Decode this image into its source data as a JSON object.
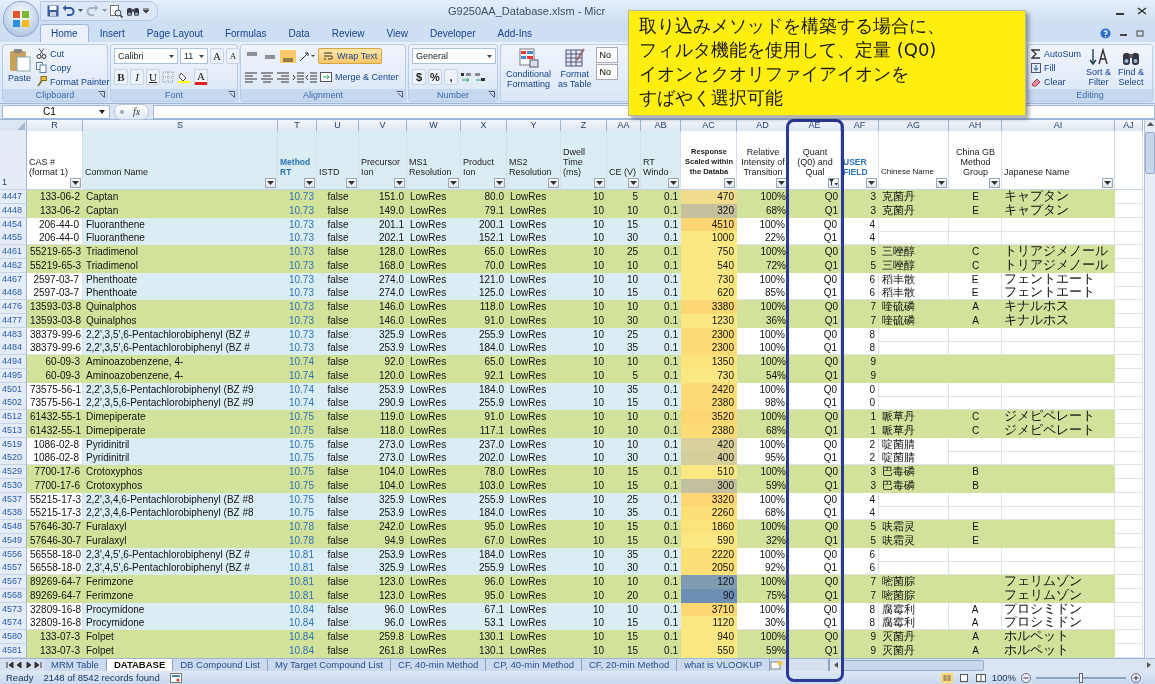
{
  "window": {
    "title": "G9250AA_Database.xlsm - Micr"
  },
  "ribbon": {
    "tabs": [
      {
        "label": "Home",
        "selected": true
      },
      {
        "label": "Insert",
        "selected": false
      },
      {
        "label": "Page Layout",
        "selected": false
      },
      {
        "label": "Formulas",
        "selected": false
      },
      {
        "label": "Data",
        "selected": false
      },
      {
        "label": "Review",
        "selected": false
      },
      {
        "label": "View",
        "selected": false
      },
      {
        "label": "Developer",
        "selected": false
      },
      {
        "label": "Add-Ins",
        "selected": false
      }
    ],
    "clipboard": {
      "label": "Clipboard",
      "paste": "Paste",
      "cut": "Cut",
      "copy": "Copy",
      "format_painter": "Format Painter"
    },
    "font": {
      "label": "Font",
      "family": "Calibri",
      "size": "11",
      "grow": "A",
      "shrink": "A",
      "bold": "B",
      "italic": "I",
      "underline": "U",
      "font_color": "A"
    },
    "alignment": {
      "label": "Alignment",
      "vertical_align": [
        {
          "selected": false
        },
        {
          "selected": false
        },
        {
          "selected": true
        }
      ],
      "wrap_text": {
        "label": "Wrap Text",
        "on": true
      },
      "merge": "Merge & Center"
    },
    "number": {
      "label": "Number",
      "format": "General",
      "currency": "$",
      "percent": "%",
      "comma": ","
    },
    "styles": {
      "conditional": [
        "Conditional",
        "Formatting"
      ],
      "format_table": [
        "Format",
        "as Table"
      ],
      "style_cells": [
        "No",
        "No"
      ]
    },
    "editing": {
      "label": "Editing",
      "autosum": "AutoSum",
      "fill": "Fill",
      "clear": "Clear",
      "sort": [
        "Sort &",
        "Filter"
      ],
      "find": [
        "Find &",
        "Select"
      ]
    }
  },
  "formula_bar": {
    "name_box": "C1",
    "function_label": "fx"
  },
  "callout": {
    "lines": [
      "取り込みメソッドを構築する場合に、",
      "フィルタ機能を使用して、定量 (Q0)",
      "イオンとクオリファイアイオンを",
      "すばやく選択可能"
    ]
  },
  "sheet": {
    "header_row": "1",
    "columns": [
      {
        "letter": "R",
        "header": [
          "CAS #",
          "(format 1)"
        ],
        "kind": "plain",
        "filtered": false,
        "tinted": false
      },
      {
        "letter": "S",
        "header": [
          "Common Name"
        ],
        "kind": "plain",
        "filtered": false,
        "tinted": true
      },
      {
        "letter": "T",
        "header": [
          "Method",
          "RT"
        ],
        "kind": "accent",
        "filtered": false,
        "tinted": true
      },
      {
        "letter": "U",
        "header": [
          "ISTD"
        ],
        "kind": "plain",
        "filtered": false,
        "tinted": true
      },
      {
        "letter": "V",
        "header": [
          "Precursor",
          "Ion"
        ],
        "kind": "plain",
        "filtered": false,
        "tinted": true
      },
      {
        "letter": "W",
        "header": [
          "MS1",
          "Resolution"
        ],
        "kind": "plain",
        "filtered": false,
        "tinted": true
      },
      {
        "letter": "X",
        "header": [
          "Product",
          "Ion"
        ],
        "kind": "plain",
        "filtered": false,
        "tinted": true
      },
      {
        "letter": "Y",
        "header": [
          "MS2",
          "Resolution"
        ],
        "kind": "plain",
        "filtered": false,
        "tinted": true
      },
      {
        "letter": "Z",
        "header": [
          "Dwell",
          "Time",
          "(ms)"
        ],
        "kind": "plain",
        "filtered": false,
        "tinted": true
      },
      {
        "letter": "AA",
        "header": [
          "CE (V)"
        ],
        "kind": "plain",
        "filtered": false,
        "tinted": true
      },
      {
        "letter": "AB",
        "header": [
          "RT",
          "Windo"
        ],
        "kind": "plain",
        "filtered": false,
        "tinted": true
      },
      {
        "letter": "AC",
        "header": [
          "Response",
          "Scaled within",
          "the Databa"
        ],
        "kind": "bold",
        "filtered": false,
        "tinted": false
      },
      {
        "letter": "AD",
        "header": [
          "Relative",
          "Intensity of",
          "Transition"
        ],
        "kind": "plain",
        "filtered": false,
        "tinted": false
      },
      {
        "letter": "AE",
        "header": [
          "Quant",
          "(Q0) and",
          "Qual"
        ],
        "kind": "plain",
        "filtered": true,
        "tinted": false
      },
      {
        "letter": "AF",
        "header": [
          "USER",
          "FIELD"
        ],
        "kind": "accent",
        "filtered": false,
        "tinted": false
      },
      {
        "letter": "AG",
        "header": [
          "Chinese Name"
        ],
        "kind": "small",
        "filtered": false,
        "tinted": false
      },
      {
        "letter": "AH",
        "header": [
          "China GB",
          "Method",
          "Group"
        ],
        "kind": "plain",
        "filtered": false,
        "tinted": false
      },
      {
        "letter": "AI",
        "header": [
          "Japanese Name"
        ],
        "kind": "plain",
        "filtered": false,
        "tinted": false
      },
      {
        "letter": "AJ",
        "tinted": false
      }
    ],
    "rows": [
      {
        "row": "4447",
        "kind": "odd",
        "cas": "133-06-2",
        "name": "Captan",
        "rt": "10.73",
        "istd": "false",
        "precursor": "151.0",
        "ms1": "LowRes",
        "product": "80.0",
        "ms2": "LowRes",
        "dwell": "10",
        "ce": "5",
        "rt_window": "0.1",
        "response": "470",
        "color": "#f0dc8c",
        "relative": "100%",
        "quant": "Q0",
        "user_field": "3",
        "chinese": "克菌丹",
        "gb": "E",
        "japanese": "キャプタン"
      },
      {
        "row": "4448",
        "kind": "odd",
        "cas": "133-06-2",
        "name": "Captan",
        "rt": "10.73",
        "istd": "false",
        "precursor": "149.0",
        "ms1": "LowRes",
        "product": "79.1",
        "ms2": "LowRes",
        "dwell": "10",
        "ce": "10",
        "rt_window": "0.1",
        "response": "320",
        "color": "#c4c19c",
        "relative": "68%",
        "quant": "Q1",
        "user_field": "3",
        "chinese": "克菌丹",
        "gb": "E",
        "japanese": "キャプタン"
      },
      {
        "row": "4454",
        "kind": "even",
        "cas": "206-44-0",
        "name": "Fluoranthene",
        "rt": "10.73",
        "istd": "false",
        "precursor": "201.1",
        "ms1": "LowRes",
        "product": "200.1",
        "ms2": "LowRes",
        "dwell": "10",
        "ce": "15",
        "rt_window": "0.1",
        "response": "4510",
        "color": "#fdd674",
        "relative": "100%",
        "quant": "Q0",
        "user_field": "4"
      },
      {
        "row": "4455",
        "kind": "even",
        "cas": "206-44-0",
        "name": "Fluoranthene",
        "rt": "10.73",
        "istd": "false",
        "precursor": "202.1",
        "ms1": "LowRes",
        "product": "152.1",
        "ms2": "LowRes",
        "dwell": "10",
        "ce": "30",
        "rt_window": "0.1",
        "response": "1000",
        "color": "#fce880",
        "relative": "22%",
        "quant": "Q1",
        "user_field": "4"
      },
      {
        "row": "4461",
        "kind": "odd",
        "cas": "55219-65-3",
        "name": "Triadimenol",
        "rt": "10.73",
        "istd": "false",
        "precursor": "128.0",
        "ms1": "LowRes",
        "product": "65.0",
        "ms2": "LowRes",
        "dwell": "10",
        "ce": "25",
        "rt_window": "0.1",
        "response": "750",
        "color": "#fbe882",
        "relative": "100%",
        "quant": "Q0",
        "user_field": "5",
        "chinese": "三唑醇",
        "gb": "C",
        "japanese": "トリアジメノール"
      },
      {
        "row": "4462",
        "kind": "odd",
        "cas": "55219-65-3",
        "name": "Triadimenol",
        "rt": "10.73",
        "istd": "false",
        "precursor": "168.0",
        "ms1": "LowRes",
        "product": "70.0",
        "ms2": "LowRes",
        "dwell": "10",
        "ce": "10",
        "rt_window": "0.1",
        "response": "540",
        "color": "#fbe882",
        "relative": "72%",
        "quant": "Q1",
        "user_field": "5",
        "chinese": "三唑醇",
        "gb": "C",
        "japanese": "トリアジメノール"
      },
      {
        "row": "4467",
        "kind": "even",
        "cas": "2597-03-7",
        "name": "Phenthoate",
        "rt": "10.73",
        "istd": "false",
        "precursor": "274.0",
        "ms1": "LowRes",
        "product": "121.0",
        "ms2": "LowRes",
        "dwell": "10",
        "ce": "10",
        "rt_window": "0.1",
        "response": "730",
        "color": "#fbe882",
        "relative": "100%",
        "quant": "Q0",
        "user_field": "6",
        "chinese": "稻丰散",
        "gb": "E",
        "japanese": "フェントエート"
      },
      {
        "row": "4468",
        "kind": "even",
        "cas": "2597-03-7",
        "name": "Phenthoate",
        "rt": "10.73",
        "istd": "false",
        "precursor": "274.0",
        "ms1": "LowRes",
        "product": "125.0",
        "ms2": "LowRes",
        "dwell": "10",
        "ce": "15",
        "rt_window": "0.1",
        "response": "620",
        "color": "#fbe882",
        "relative": "85%",
        "quant": "Q1",
        "user_field": "6",
        "chinese": "稻丰散",
        "gb": "E",
        "japanese": "フェントエート"
      },
      {
        "row": "4476",
        "kind": "odd",
        "cas": "13593-03-8",
        "name": "Quinalphos",
        "rt": "10.73",
        "istd": "false",
        "precursor": "146.0",
        "ms1": "LowRes",
        "product": "118.0",
        "ms2": "LowRes",
        "dwell": "10",
        "ce": "10",
        "rt_window": "0.1",
        "response": "3380",
        "color": "#fdd773",
        "relative": "100%",
        "quant": "Q0",
        "user_field": "7",
        "chinese": "喹硫磷",
        "gb": "A",
        "japanese": "キナルホス"
      },
      {
        "row": "4477",
        "kind": "odd",
        "cas": "13593-03-8",
        "name": "Quinalphos",
        "rt": "10.73",
        "istd": "false",
        "precursor": "146.0",
        "ms1": "LowRes",
        "product": "91.0",
        "ms2": "LowRes",
        "dwell": "10",
        "ce": "30",
        "rt_window": "0.1",
        "response": "1230",
        "color": "#fbe882",
        "relative": "36%",
        "quant": "Q1",
        "user_field": "7",
        "chinese": "喹硫磷",
        "gb": "A",
        "japanese": "キナルホス"
      },
      {
        "row": "4483",
        "kind": "even",
        "cas": "38379-99-6",
        "name": "2,2',3,5',6-Pentachlorobiphenyl (BZ #",
        "rt": "10.73",
        "istd": "false",
        "precursor": "325.9",
        "ms1": "LowRes",
        "product": "255.9",
        "ms2": "LowRes",
        "dwell": "10",
        "ce": "25",
        "rt_window": "0.1",
        "response": "2300",
        "color": "#fddc77",
        "relative": "100%",
        "quant": "Q0",
        "user_field": "8"
      },
      {
        "row": "4484",
        "kind": "even",
        "cas": "38379-99-6",
        "name": "2,2',3,5',6-Pentachlorobiphenyl (BZ #",
        "rt": "10.73",
        "istd": "false",
        "precursor": "253.9",
        "ms1": "LowRes",
        "product": "184.0",
        "ms2": "LowRes",
        "dwell": "10",
        "ce": "35",
        "rt_window": "0.1",
        "response": "2300",
        "color": "#fddc77",
        "relative": "100%",
        "quant": "Q1",
        "user_field": "8"
      },
      {
        "row": "4494",
        "kind": "odd",
        "cas": "60-09-3",
        "name": "Aminoazobenzene, 4-",
        "rt": "10.74",
        "istd": "false",
        "precursor": "92.0",
        "ms1": "LowRes",
        "product": "65.0",
        "ms2": "LowRes",
        "dwell": "10",
        "ce": "10",
        "rt_window": "0.1",
        "response": "1350",
        "color": "#fde37c",
        "relative": "100%",
        "quant": "Q0",
        "user_field": "9"
      },
      {
        "row": "4495",
        "kind": "odd",
        "cas": "60-09-3",
        "name": "Aminoazobenzene, 4-",
        "rt": "10.74",
        "istd": "false",
        "precursor": "120.0",
        "ms1": "LowRes",
        "product": "92.1",
        "ms2": "LowRes",
        "dwell": "10",
        "ce": "5",
        "rt_window": "0.1",
        "response": "730",
        "color": "#fbe882",
        "relative": "54%",
        "quant": "Q1",
        "user_field": "9"
      },
      {
        "row": "4501",
        "kind": "even",
        "cas": "73575-56-1",
        "name": "2,2',3,5,6-Pentachlorobiphenyl (BZ #9",
        "rt": "10.74",
        "istd": "false",
        "precursor": "253.9",
        "ms1": "LowRes",
        "product": "184.0",
        "ms2": "LowRes",
        "dwell": "10",
        "ce": "35",
        "rt_window": "0.1",
        "response": "2420",
        "color": "#fddc77",
        "relative": "100%",
        "quant": "Q0",
        "user_field": "0"
      },
      {
        "row": "4502",
        "kind": "even",
        "cas": "73575-56-1",
        "name": "2,2',3,5,6-Pentachlorobiphenyl (BZ #9",
        "rt": "10.74",
        "istd": "false",
        "precursor": "290.9",
        "ms1": "LowRes",
        "product": "255.9",
        "ms2": "LowRes",
        "dwell": "10",
        "ce": "15",
        "rt_window": "0.1",
        "response": "2380",
        "color": "#fddc77",
        "relative": "98%",
        "quant": "Q1",
        "user_field": "0"
      },
      {
        "row": "4512",
        "kind": "odd",
        "cas": "61432-55-1",
        "name": "Dimepiperate",
        "rt": "10.75",
        "istd": "false",
        "precursor": "119.0",
        "ms1": "LowRes",
        "product": "91.0",
        "ms2": "LowRes",
        "dwell": "10",
        "ce": "10",
        "rt_window": "0.1",
        "response": "3520",
        "color": "#fdd773",
        "relative": "100%",
        "quant": "Q0",
        "user_field": "1",
        "chinese": "哌草丹",
        "gb": "C",
        "japanese": "ジメピペレート"
      },
      {
        "row": "4513",
        "kind": "odd",
        "cas": "61432-55-1",
        "name": "Dimepiperate",
        "rt": "10.75",
        "istd": "false",
        "precursor": "118.0",
        "ms1": "LowRes",
        "product": "117.1",
        "ms2": "LowRes",
        "dwell": "10",
        "ce": "10",
        "rt_window": "0.1",
        "response": "2380",
        "color": "#fddc77",
        "relative": "68%",
        "quant": "Q1",
        "user_field": "1",
        "chinese": "哌草丹",
        "gb": "C",
        "japanese": "ジメピペレート"
      },
      {
        "row": "4519",
        "kind": "even",
        "cas": "1086-02-8",
        "name": "Pyridinitril",
        "rt": "10.75",
        "istd": "false",
        "precursor": "273.0",
        "ms1": "LowRes",
        "product": "237.0",
        "ms2": "LowRes",
        "dwell": "10",
        "ce": "10",
        "rt_window": "0.1",
        "response": "420",
        "color": "#d8d19b",
        "relative": "100%",
        "quant": "Q0",
        "user_field": "2",
        "chinese": "啶菌腈"
      },
      {
        "row": "4520",
        "kind": "even",
        "cas": "1086-02-8",
        "name": "Pyridinitril",
        "rt": "10.75",
        "istd": "false",
        "precursor": "273.0",
        "ms1": "LowRes",
        "product": "202.0",
        "ms2": "LowRes",
        "dwell": "10",
        "ce": "30",
        "rt_window": "0.1",
        "response": "400",
        "color": "#d4ce9d",
        "relative": "95%",
        "quant": "Q1",
        "user_field": "2",
        "chinese": "啶菌腈"
      },
      {
        "row": "4529",
        "kind": "odd",
        "cas": "7700-17-6",
        "name": "Crotoxyphos",
        "rt": "10.75",
        "istd": "false",
        "precursor": "104.0",
        "ms1": "LowRes",
        "product": "78.0",
        "ms2": "LowRes",
        "dwell": "10",
        "ce": "15",
        "rt_window": "0.1",
        "response": "510",
        "color": "#fbe882",
        "relative": "100%",
        "quant": "Q0",
        "user_field": "3",
        "chinese": "巴毒磷",
        "gb": "B"
      },
      {
        "row": "4530",
        "kind": "odd",
        "cas": "7700-17-6",
        "name": "Crotoxyphos",
        "rt": "10.75",
        "istd": "false",
        "precursor": "104.0",
        "ms1": "LowRes",
        "product": "103.0",
        "ms2": "LowRes",
        "dwell": "10",
        "ce": "15",
        "rt_window": "0.1",
        "response": "300",
        "color": "#c3c09f",
        "relative": "59%",
        "quant": "Q1",
        "user_field": "3",
        "chinese": "巴毒磷",
        "gb": "B"
      },
      {
        "row": "4537",
        "kind": "even",
        "cas": "55215-17-3",
        "name": "2,2',3,4,6-Pentachlorobiphenyl (BZ #8",
        "rt": "10.75",
        "istd": "false",
        "precursor": "325.9",
        "ms1": "LowRes",
        "product": "255.9",
        "ms2": "LowRes",
        "dwell": "10",
        "ce": "25",
        "rt_window": "0.1",
        "response": "3320",
        "color": "#fdd773",
        "relative": "100%",
        "quant": "Q0",
        "user_field": "4"
      },
      {
        "row": "4538",
        "kind": "even",
        "cas": "55215-17-3",
        "name": "2,2',3,4,6-Pentachlorobiphenyl (BZ #8",
        "rt": "10.75",
        "istd": "false",
        "precursor": "253.9",
        "ms1": "LowRes",
        "product": "184.0",
        "ms2": "LowRes",
        "dwell": "10",
        "ce": "35",
        "rt_window": "0.1",
        "response": "2260",
        "color": "#fddf78",
        "relative": "68%",
        "quant": "Q1",
        "user_field": "4"
      },
      {
        "row": "4548",
        "kind": "odd",
        "cas": "57646-30-7",
        "name": "Furalaxyl",
        "rt": "10.78",
        "istd": "false",
        "precursor": "242.0",
        "ms1": "LowRes",
        "product": "95.0",
        "ms2": "LowRes",
        "dwell": "10",
        "ce": "15",
        "rt_window": "0.1",
        "response": "1860",
        "color": "#fde37c",
        "relative": "100%",
        "quant": "Q0",
        "user_field": "5",
        "chinese": "呋霜灵",
        "gb": "E"
      },
      {
        "row": "4549",
        "kind": "odd",
        "cas": "57646-30-7",
        "name": "Furalaxyl",
        "rt": "10.78",
        "istd": "false",
        "precursor": "94.9",
        "ms1": "LowRes",
        "product": "67.0",
        "ms2": "LowRes",
        "dwell": "10",
        "ce": "15",
        "rt_window": "0.1",
        "response": "590",
        "color": "#fbe882",
        "relative": "32%",
        "quant": "Q1",
        "user_field": "5",
        "chinese": "呋霜灵",
        "gb": "E"
      },
      {
        "row": "4556",
        "kind": "even",
        "cas": "56558-18-0",
        "name": "2,3',4,5',6-Pentachlorobiphenyl (BZ #",
        "rt": "10.81",
        "istd": "false",
        "precursor": "253.9",
        "ms1": "LowRes",
        "product": "184.0",
        "ms2": "LowRes",
        "dwell": "10",
        "ce": "35",
        "rt_window": "0.1",
        "response": "2220",
        "color": "#fddf78",
        "relative": "100%",
        "quant": "Q0",
        "user_field": "6"
      },
      {
        "row": "4557",
        "kind": "even",
        "cas": "56558-18-0",
        "name": "2,3',4,5',6-Pentachlorobiphenyl (BZ #",
        "rt": "10.81",
        "istd": "false",
        "precursor": "325.9",
        "ms1": "LowRes",
        "product": "255.9",
        "ms2": "LowRes",
        "dwell": "10",
        "ce": "30",
        "rt_window": "0.1",
        "response": "2050",
        "color": "#fddf78",
        "relative": "92%",
        "quant": "Q1",
        "user_field": "6"
      },
      {
        "row": "4567",
        "kind": "odd",
        "cas": "89269-64-7",
        "name": "Ferimzone",
        "rt": "10.81",
        "istd": "false",
        "precursor": "123.0",
        "ms1": "LowRes",
        "product": "96.0",
        "ms2": "LowRes",
        "dwell": "10",
        "ce": "10",
        "rt_window": "0.1",
        "response": "120",
        "color": "#7f9cb2",
        "relative": "100%",
        "quant": "Q0",
        "user_field": "7",
        "chinese": "嘧菌腙",
        "japanese": "フェリムゾン"
      },
      {
        "row": "4568",
        "kind": "odd",
        "cas": "89269-64-7",
        "name": "Ferimzone",
        "rt": "10.81",
        "istd": "false",
        "precursor": "123.0",
        "ms1": "LowRes",
        "product": "95.0",
        "ms2": "LowRes",
        "dwell": "10",
        "ce": "20",
        "rt_window": "0.1",
        "response": "90",
        "color": "#6d8fb3",
        "relative": "75%",
        "quant": "Q1",
        "user_field": "7",
        "chinese": "嘧菌腙",
        "japanese": "フェリムゾン"
      },
      {
        "row": "4573",
        "kind": "even",
        "cas": "32809-16-8",
        "name": "Procymidone",
        "rt": "10.84",
        "istd": "false",
        "precursor": "96.0",
        "ms1": "LowRes",
        "product": "67.1",
        "ms2": "LowRes",
        "dwell": "10",
        "ce": "10",
        "rt_window": "0.1",
        "response": "3710",
        "color": "#fdd773",
        "relative": "100%",
        "quant": "Q0",
        "user_field": "8",
        "chinese": "腐霉利",
        "gb": "A",
        "japanese": "プロシミドン"
      },
      {
        "row": "4574",
        "kind": "even",
        "cas": "32809-16-8",
        "name": "Procymidone",
        "rt": "10.84",
        "istd": "false",
        "precursor": "96.0",
        "ms1": "LowRes",
        "product": "53.1",
        "ms2": "LowRes",
        "dwell": "10",
        "ce": "15",
        "rt_window": "0.1",
        "response": "1120",
        "color": "#fbe882",
        "relative": "30%",
        "quant": "Q1",
        "user_field": "8",
        "chinese": "腐霉利",
        "gb": "A",
        "japanese": "プロシミドン"
      },
      {
        "row": "4580",
        "kind": "odd",
        "cas": "133-07-3",
        "name": "Folpet",
        "rt": "10.84",
        "istd": "false",
        "precursor": "259.8",
        "ms1": "LowRes",
        "product": "130.1",
        "ms2": "LowRes",
        "dwell": "10",
        "ce": "15",
        "rt_window": "0.1",
        "response": "940",
        "color": "#fbe882",
        "relative": "100%",
        "quant": "Q0",
        "user_field": "9",
        "chinese": "灭菌丹",
        "gb": "A",
        "japanese": "ホルペット"
      },
      {
        "row": "4581",
        "kind": "odd",
        "cas": "133-07-3",
        "name": "Folpet",
        "rt": "10.84",
        "istd": "false",
        "precursor": "261.8",
        "ms1": "LowRes",
        "product": "130.1",
        "ms2": "LowRes",
        "dwell": "10",
        "ce": "15",
        "rt_window": "0.1",
        "response": "550",
        "color": "#fbe882",
        "relative": "59%",
        "quant": "Q1",
        "user_field": "9",
        "chinese": "灭菌丹",
        "gb": "A",
        "japanese": "ホルペット"
      }
    ]
  },
  "sheet_tabs": [
    {
      "label": "MRM Table",
      "selected": false
    },
    {
      "label": "DATABASE",
      "selected": true
    },
    {
      "label": "DB Compound List",
      "selected": false
    },
    {
      "label": "My Target Compound List",
      "selected": false
    },
    {
      "label": "CF, 40-min Method",
      "selected": false
    },
    {
      "label": "CP, 40-min Method",
      "selected": false
    },
    {
      "label": "CF, 20-min Method",
      "selected": false
    },
    {
      "label": "what is VLOOKUP",
      "selected": false
    }
  ],
  "status_bar": {
    "mode": "Ready",
    "records": "2148 of 8542 records found",
    "zoom": "100%",
    "zoom_slider": {
      "level": 0.5
    }
  }
}
